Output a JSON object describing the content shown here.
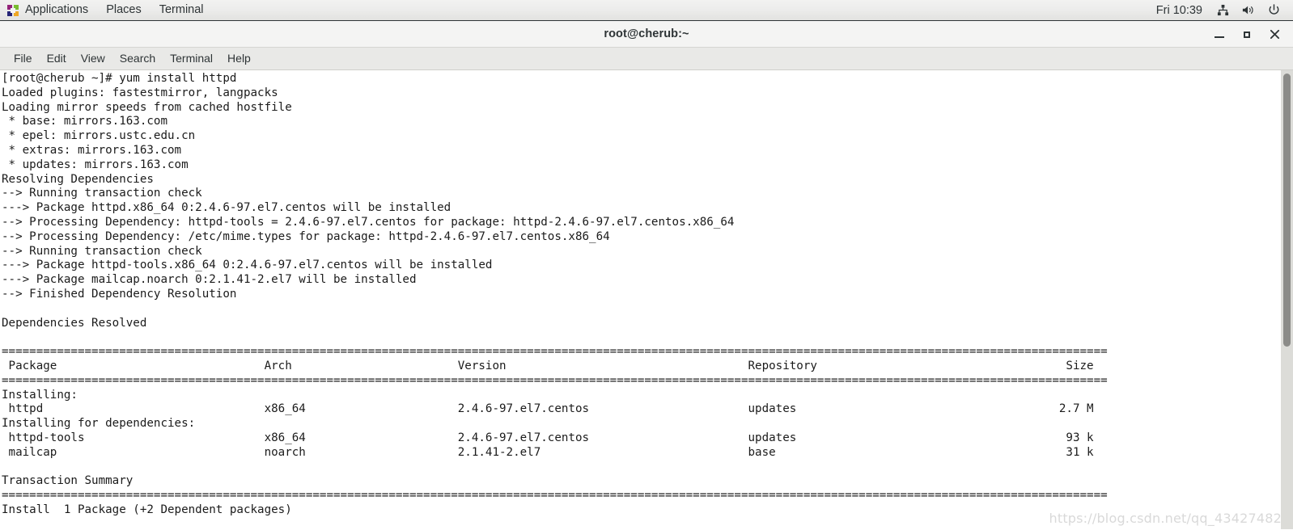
{
  "panel": {
    "logo_icon": "centos-logo-icon",
    "items": [
      {
        "label": "Applications",
        "name": "applications"
      },
      {
        "label": "Places",
        "name": "places"
      },
      {
        "label": "Terminal",
        "name": "terminal"
      }
    ],
    "clock": "Fri 10:39",
    "tray": [
      {
        "name": "network-icon"
      },
      {
        "name": "volume-icon"
      },
      {
        "name": "power-icon"
      }
    ]
  },
  "window": {
    "title": "root@cherub:~",
    "buttons": {
      "minimize": "minimize-button",
      "maximize": "maximize-button",
      "close": "close-button"
    }
  },
  "menu": {
    "items": [
      {
        "label": "File"
      },
      {
        "label": "Edit"
      },
      {
        "label": "View"
      },
      {
        "label": "Search"
      },
      {
        "label": "Terminal"
      },
      {
        "label": "Help"
      }
    ]
  },
  "terminal": {
    "prompt": "[root@cherub ~]#",
    "command": "yum install httpd",
    "lines": [
      "[root@cherub ~]# yum install httpd",
      "Loaded plugins: fastestmirror, langpacks",
      "Loading mirror speeds from cached hostfile",
      " * base: mirrors.163.com",
      " * epel: mirrors.ustc.edu.cn",
      " * extras: mirrors.163.com",
      " * updates: mirrors.163.com",
      "Resolving Dependencies",
      "--> Running transaction check",
      "---> Package httpd.x86_64 0:2.4.6-97.el7.centos will be installed",
      "--> Processing Dependency: httpd-tools = 2.4.6-97.el7.centos for package: httpd-2.4.6-97.el7.centos.x86_64",
      "--> Processing Dependency: /etc/mime.types for package: httpd-2.4.6-97.el7.centos.x86_64",
      "--> Running transaction check",
      "---> Package httpd-tools.x86_64 0:2.4.6-97.el7.centos will be installed",
      "---> Package mailcap.noarch 0:2.1.41-2.el7 will be installed",
      "--> Finished Dependency Resolution",
      "",
      "Dependencies Resolved",
      "",
      "================================================================================================================================================================",
      " Package                              Arch                        Version                                   Repository                                    Size",
      "================================================================================================================================================================",
      "Installing:",
      " httpd                                x86_64                      2.4.6-97.el7.centos                       updates                                      2.7 M",
      "Installing for dependencies:",
      " httpd-tools                          x86_64                      2.4.6-97.el7.centos                       updates                                       93 k",
      " mailcap                              noarch                      2.1.41-2.el7                              base                                          31 k",
      "",
      "Transaction Summary",
      "================================================================================================================================================================",
      "Install  1 Package (+2 Dependent packages)"
    ],
    "table": {
      "columns": [
        "Package",
        "Arch",
        "Version",
        "Repository",
        "Size"
      ],
      "sections": [
        {
          "title": "Installing:",
          "rows": [
            {
              "package": "httpd",
              "arch": "x86_64",
              "version": "2.4.6-97.el7.centos",
              "repository": "updates",
              "size": "2.7 M"
            }
          ]
        },
        {
          "title": "Installing for dependencies:",
          "rows": [
            {
              "package": "httpd-tools",
              "arch": "x86_64",
              "version": "2.4.6-97.el7.centos",
              "repository": "updates",
              "size": "93 k"
            },
            {
              "package": "mailcap",
              "arch": "noarch",
              "version": "2.1.41-2.el7",
              "repository": "base",
              "size": "31 k"
            }
          ]
        }
      ],
      "summary_title": "Transaction Summary",
      "summary_line": "Install  1 Package (+2 Dependent packages)"
    },
    "mirrors": [
      {
        "repo": "base",
        "host": "mirrors.163.com"
      },
      {
        "repo": "epel",
        "host": "mirrors.ustc.edu.cn"
      },
      {
        "repo": "extras",
        "host": "mirrors.163.com"
      },
      {
        "repo": "updates",
        "host": "mirrors.163.com"
      }
    ]
  },
  "watermark": "https://blog.csdn.net/qq_43427482",
  "colors": {
    "panel_bg": "#ececeb",
    "titlebar_bg": "#f4f4f3",
    "menubar_bg": "#e9e9e7",
    "terminal_bg": "#ffffff",
    "terminal_fg": "#1b1b1b",
    "scrollbar_thumb": "#8b8b88",
    "watermark": "#d9d9d9"
  }
}
